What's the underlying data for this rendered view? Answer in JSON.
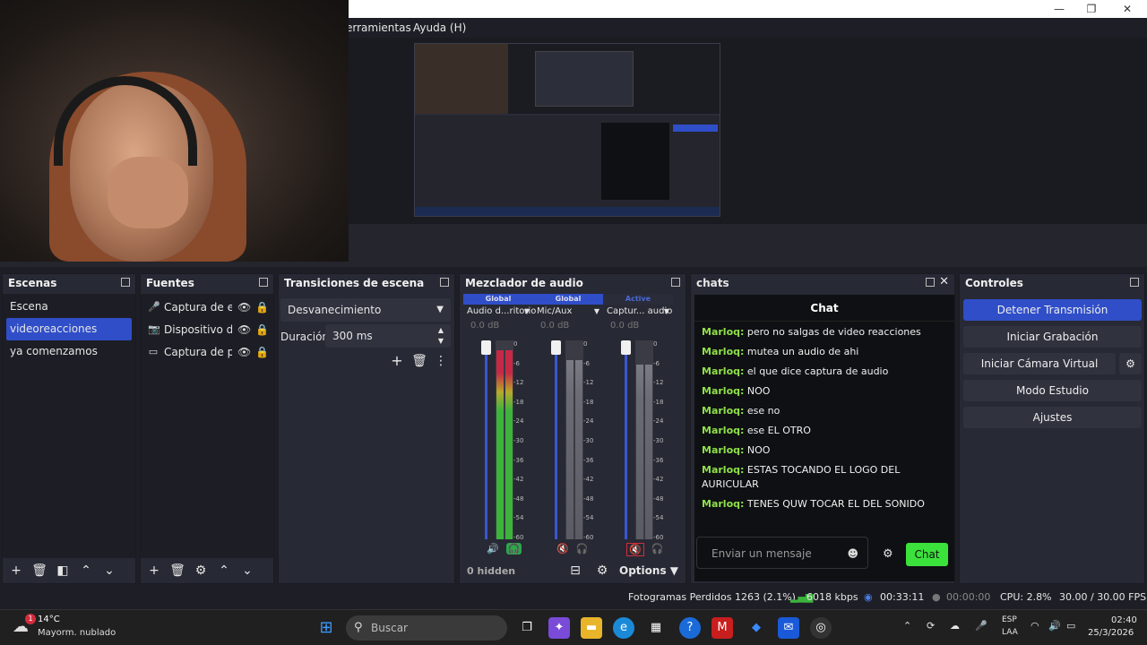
{
  "window": {
    "minimize": "—",
    "maximize": "❐",
    "close": "✕"
  },
  "menu": {
    "tools": "erramientas",
    "help": "Ayuda (H)"
  },
  "scenes": {
    "title": "Escenas",
    "items": [
      {
        "label": "Escena"
      },
      {
        "label": "videoreacciones",
        "selected": true
      },
      {
        "label": "ya comenzamos"
      }
    ]
  },
  "sources": {
    "title": "Fuentes",
    "items": [
      {
        "label": "Captura de entrada",
        "icon": "microphone-icon"
      },
      {
        "label": "Dispositivo de vídeo",
        "icon": "camera-icon"
      },
      {
        "label": "Captura de pantalla",
        "icon": "monitor-icon"
      }
    ]
  },
  "transitions": {
    "title": "Transiciones de escena",
    "selected": "Desvanecimiento",
    "duration_label": "Duración",
    "duration_value": "300 ms"
  },
  "mixer": {
    "title": "Mezclador de audio",
    "channels": [
      {
        "group": "Global",
        "name": "Audio d...ritorio",
        "db": "0.0 dB",
        "muted": false,
        "level": 0.95
      },
      {
        "group": "Global",
        "name": "Mic/Aux",
        "db": "0.0 dB",
        "muted": true,
        "level": 0.9
      },
      {
        "group": "Active",
        "name": "Captur... audio",
        "db": "0.0 dB",
        "muted": true,
        "level": 0.88
      }
    ],
    "scale": [
      "0",
      "-6",
      "-12",
      "-18",
      "-24",
      "-30",
      "-36",
      "-42",
      "-48",
      "-54",
      "-60"
    ],
    "hidden": "0 hidden",
    "options": "Options"
  },
  "chat_dock": {
    "title": "chats",
    "header": "Chat",
    "messages": [
      {
        "user": "Marloq:",
        "text": "pero no salgas de video reacciones"
      },
      {
        "user": "Marloq:",
        "text": "mutea un audio de ahi"
      },
      {
        "user": "Marloq:",
        "text": "el que dice captura de audio"
      },
      {
        "user": "Marloq:",
        "text": "NOO"
      },
      {
        "user": "Marloq:",
        "text": "ese no"
      },
      {
        "user": "Marloq:",
        "text": "ese EL OTRO"
      },
      {
        "user": "Marloq:",
        "text": "NOO"
      },
      {
        "user": "Marloq:",
        "text": "ESTAS TOCANDO EL LOGO DEL AURICULAR"
      },
      {
        "user": "Marloq:",
        "text": "TENES QUW TOCAR EL DEL SONIDO"
      }
    ],
    "input_placeholder": "Enviar un mensaje",
    "send_label": "Chat"
  },
  "controls": {
    "title": "Controles",
    "stop_stream": "Detener Transmisión",
    "start_recording": "Iniciar Grabación",
    "start_virtual_cam": "Iniciar Cámara Virtual",
    "studio_mode": "Modo Estudio",
    "settings": "Ajustes"
  },
  "status": {
    "dropped_frames": "Fotogramas Perdidos 1263 (2.1%)",
    "bitrate": "6018 kbps",
    "stream_time": "00:33:11",
    "record_time": "00:00:00",
    "cpu": "CPU: 2.8%",
    "fps": "30.00 / 30.00 FPS"
  },
  "taskbar": {
    "weather_temp": "14°C",
    "weather_desc": "Mayorm. nublado",
    "weather_badge": "1",
    "search_placeholder": "Buscar",
    "lang_top": "ESP",
    "lang_bottom": "LAA",
    "time": "02:40",
    "date": "25/3/2026"
  },
  "colors": {
    "accent": "#2f4ec8",
    "chat_user": "#8fe04a",
    "send_button": "#3ce23c",
    "meter_green": "#3cb43c",
    "meter_red": "#c82846",
    "muted_red": "#d22d3c"
  }
}
